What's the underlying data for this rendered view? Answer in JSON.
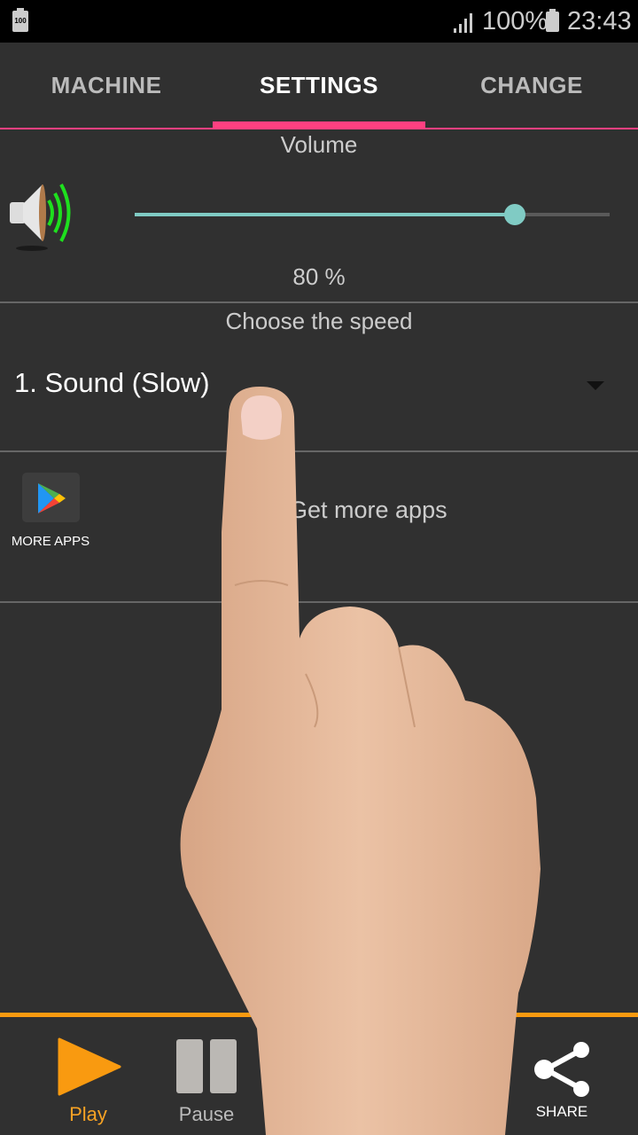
{
  "status_bar": {
    "left_battery_label": "100",
    "battery_percent": "100%",
    "time": "23:43"
  },
  "tabs": [
    {
      "label": "MACHINE",
      "active": false
    },
    {
      "label": "SETTINGS",
      "active": true
    },
    {
      "label": "CHANGE",
      "active": false
    }
  ],
  "volume": {
    "title": "Volume",
    "value": 0.8,
    "value_label": "80 %"
  },
  "speed": {
    "title": "Choose the speed",
    "selected": "1. Sound (Slow)"
  },
  "more_apps": {
    "icon_label": "MORE APPS",
    "text": "Get more apps"
  },
  "bottom_bar": {
    "play_label": "Play",
    "pause_label": "Pause",
    "share_label": "SHARE"
  },
  "colors": {
    "accent_pink": "#ff4081",
    "slider_teal": "#80cbc4",
    "orange": "#f99a10",
    "background": "#303030"
  }
}
